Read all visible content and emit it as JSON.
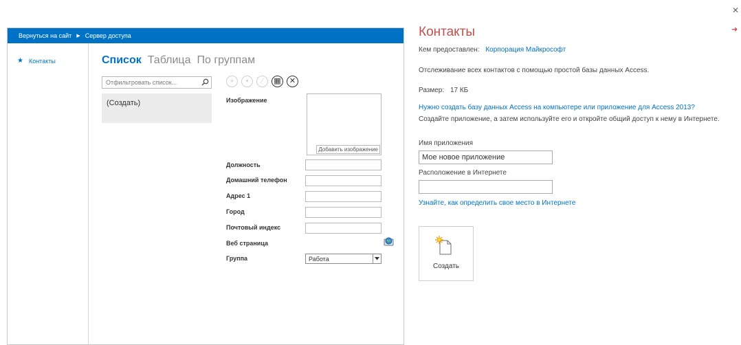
{
  "preview": {
    "breadcrumb": [
      "Вернуться на сайт",
      "Сервер доступа"
    ],
    "nav_items": [
      {
        "label": "Контакты",
        "icon": "star-icon"
      }
    ],
    "view_tabs": [
      "Список",
      "Таблица",
      "По группам"
    ],
    "active_tab": "Список",
    "filter_placeholder": "Отфильтровать список...",
    "list_items": [
      "(Создать)"
    ],
    "action_icons": [
      "add-icon",
      "delete-icon",
      "edit-icon",
      "save-icon",
      "cancel-icon"
    ],
    "form": {
      "image_label": "Изображение",
      "add_image_label": "Добавить изображение",
      "position_label": "Должность",
      "home_phone_label": "Домашний телефон",
      "address_label": "Адрес 1",
      "city_label": "Город",
      "zip_label": "Почтовый индекс",
      "web_label": "Веб страница",
      "group_label": "Группа",
      "group_value": "Работа"
    }
  },
  "details": {
    "title": "Контакты",
    "provided_by_label": "Кем предоставлен:",
    "provided_by_value": "Корпорация Майкрософт",
    "description": "Отслеживание всех контактов с помощью простой базы данных Access.",
    "size_label": "Размер:",
    "size_value": "17 КБ",
    "desktop_link": "Нужно создать базу данных Access на компьютере или приложение для Access 2013?",
    "instructions": "Создайте приложение, а затем используйте его и откройте общий доступ к нему в Интернете.",
    "app_name_label": "Имя приложения",
    "app_name_value": "Мое новое приложение",
    "location_label": "Расположение в Интернете",
    "location_value": "",
    "location_help_link": "Узнайте, как определить свое место в Интернете",
    "create_label": "Создать"
  },
  "colors": {
    "accent_blue": "#0072c6",
    "title_red": "#c0504d",
    "list_bg": "#ececec"
  }
}
